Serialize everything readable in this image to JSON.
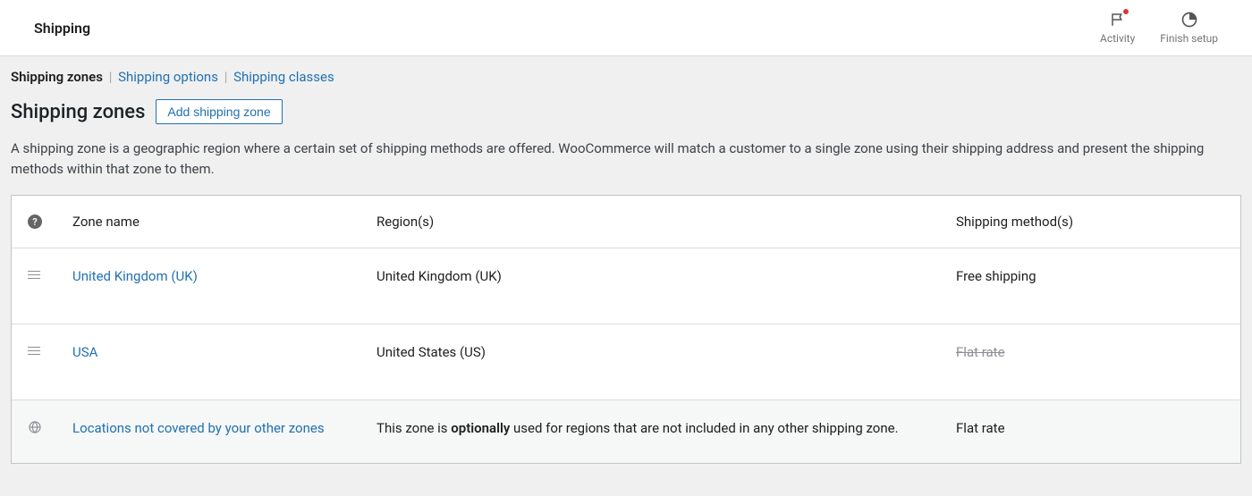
{
  "topbar": {
    "title": "Shipping",
    "buttons": {
      "activity": "Activity",
      "finish_setup": "Finish setup"
    }
  },
  "subnav": {
    "zones": "Shipping zones",
    "options": "Shipping options",
    "classes": "Shipping classes"
  },
  "heading": {
    "title": "Shipping zones",
    "add_button": "Add shipping zone"
  },
  "description": "A shipping zone is a geographic region where a certain set of shipping methods are offered. WooCommerce will match a customer to a single zone using their shipping address and present the shipping methods within that zone to them.",
  "table": {
    "headers": {
      "name": "Zone name",
      "region": "Region(s)",
      "method": "Shipping method(s)"
    },
    "zones": [
      {
        "name": "United Kingdom (UK)",
        "region": "United Kingdom (UK)",
        "method": "Free shipping",
        "method_disabled": false
      },
      {
        "name": "USA",
        "region": "United States (US)",
        "method": "Flat rate",
        "method_disabled": true
      }
    ],
    "rest": {
      "name": "Locations not covered by your other zones",
      "region_pre": "This zone is ",
      "region_bold": "optionally",
      "region_post": " used for regions that are not included in any other shipping zone.",
      "method": "Flat rate"
    }
  }
}
